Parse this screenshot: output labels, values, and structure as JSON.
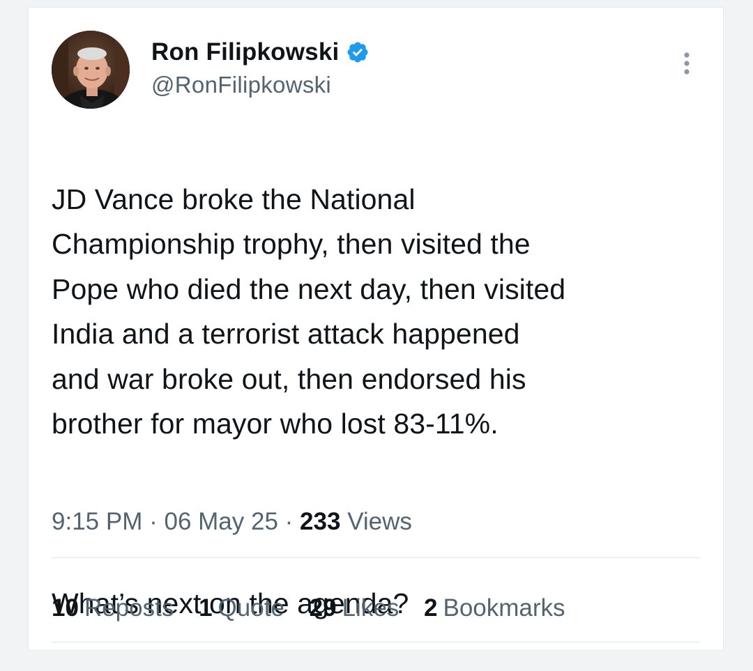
{
  "author": {
    "display_name": "Ron Filipkowski",
    "handle": "@RonFilipkowski",
    "verified": true,
    "avatar_icon": "profile-photo"
  },
  "tweet": {
    "text_paragraph_1": "JD Vance broke the National\nChampionship trophy, then visited the\nPope who died the next day, then visited\nIndia and a terrorist attack happened\nand war broke out, then endorsed his\nbrother for mayor who lost 83-11%.",
    "text_paragraph_2": "What’s next on the agenda?",
    "time": "9:15 PM",
    "separator": "·",
    "date": "06 May 25",
    "views_count": "233",
    "views_label": "Views"
  },
  "stats": {
    "reposts": {
      "count": "10",
      "label": "Reposts"
    },
    "quotes": {
      "count": "1",
      "label": "Quote"
    },
    "likes": {
      "count": "29",
      "label": "Likes"
    },
    "bookmarks": {
      "count": "2",
      "label": "Bookmarks"
    }
  },
  "colors": {
    "verified_badge": "#1d9bf0",
    "secondary_text": "#536471",
    "primary_text": "#0f1419"
  },
  "icons": [
    "verified-badge-icon",
    "more-options-icon"
  ]
}
